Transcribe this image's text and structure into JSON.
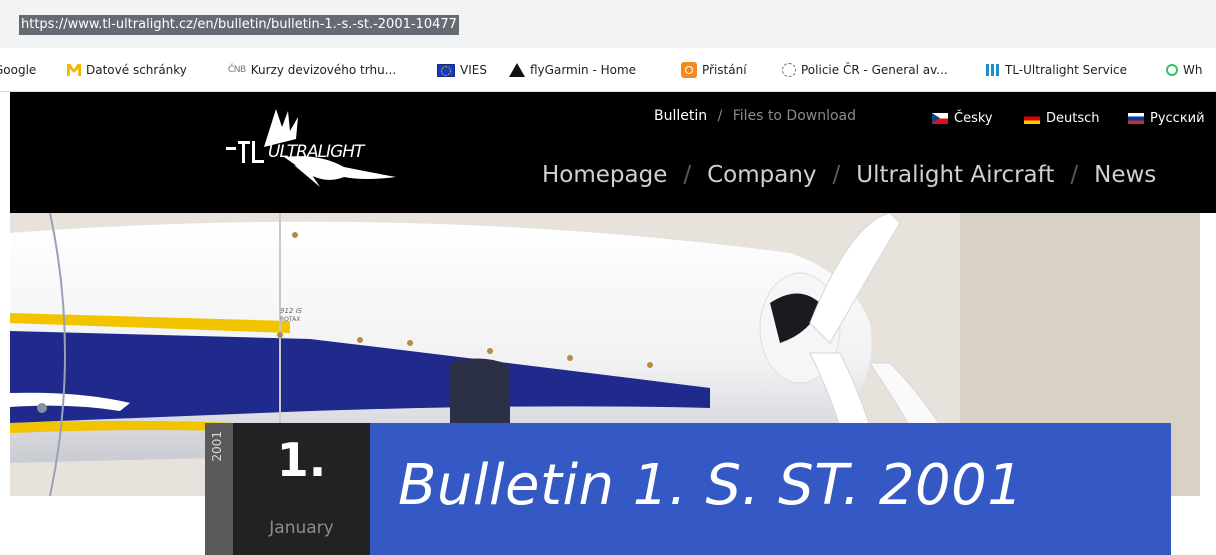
{
  "browser": {
    "url": "https://www.tl-ultralight.cz/en/bulletin/bulletin-1.-s.-st.-2001-10477"
  },
  "bookmarks": [
    {
      "label": "Google",
      "icon": "google-icon"
    },
    {
      "label": "Datové schránky",
      "icon": "mailbox-icon"
    },
    {
      "label": "Kurzy devizového trhu...",
      "icon": "cnb-icon"
    },
    {
      "label": "VIES",
      "icon": "eu-flag-icon"
    },
    {
      "label": "flyGarmin - Home",
      "icon": "garmin-triangle-icon"
    },
    {
      "label": "Přistání",
      "icon": "landing-icon"
    },
    {
      "label": "Policie ČR - General av...",
      "icon": "police-icon"
    },
    {
      "label": "TL-Ultralight Service",
      "icon": "tl-service-icon"
    },
    {
      "label": "Wh",
      "icon": "whatsapp-icon"
    }
  ],
  "site": {
    "logo_text": "ULTRALIGHT",
    "top_links": {
      "bulletin": "Bulletin",
      "separator": "/",
      "files": "Files to Download"
    },
    "languages": [
      {
        "label": "Česky",
        "flag": "czech-flag-icon"
      },
      {
        "label": "Deutsch",
        "flag": "german-flag-icon"
      },
      {
        "label": "Русский",
        "flag": "russian-flag-icon"
      }
    ],
    "main_nav": [
      {
        "label": "Homepage"
      },
      {
        "label": "Company"
      },
      {
        "label": "Ultralight Aircraft"
      },
      {
        "label": "News"
      }
    ],
    "nav_separator": "/",
    "engine_label": "912 iS",
    "engine_brand": "ROTAX"
  },
  "article": {
    "year": "2001",
    "day": "1.",
    "month": "January",
    "title": "Bulletin 1. S. ST. 2001"
  },
  "colors": {
    "title_bg": "#3559c4",
    "date_bg": "#222222",
    "year_bg": "#5a5a5a",
    "header_bg": "#000000"
  }
}
